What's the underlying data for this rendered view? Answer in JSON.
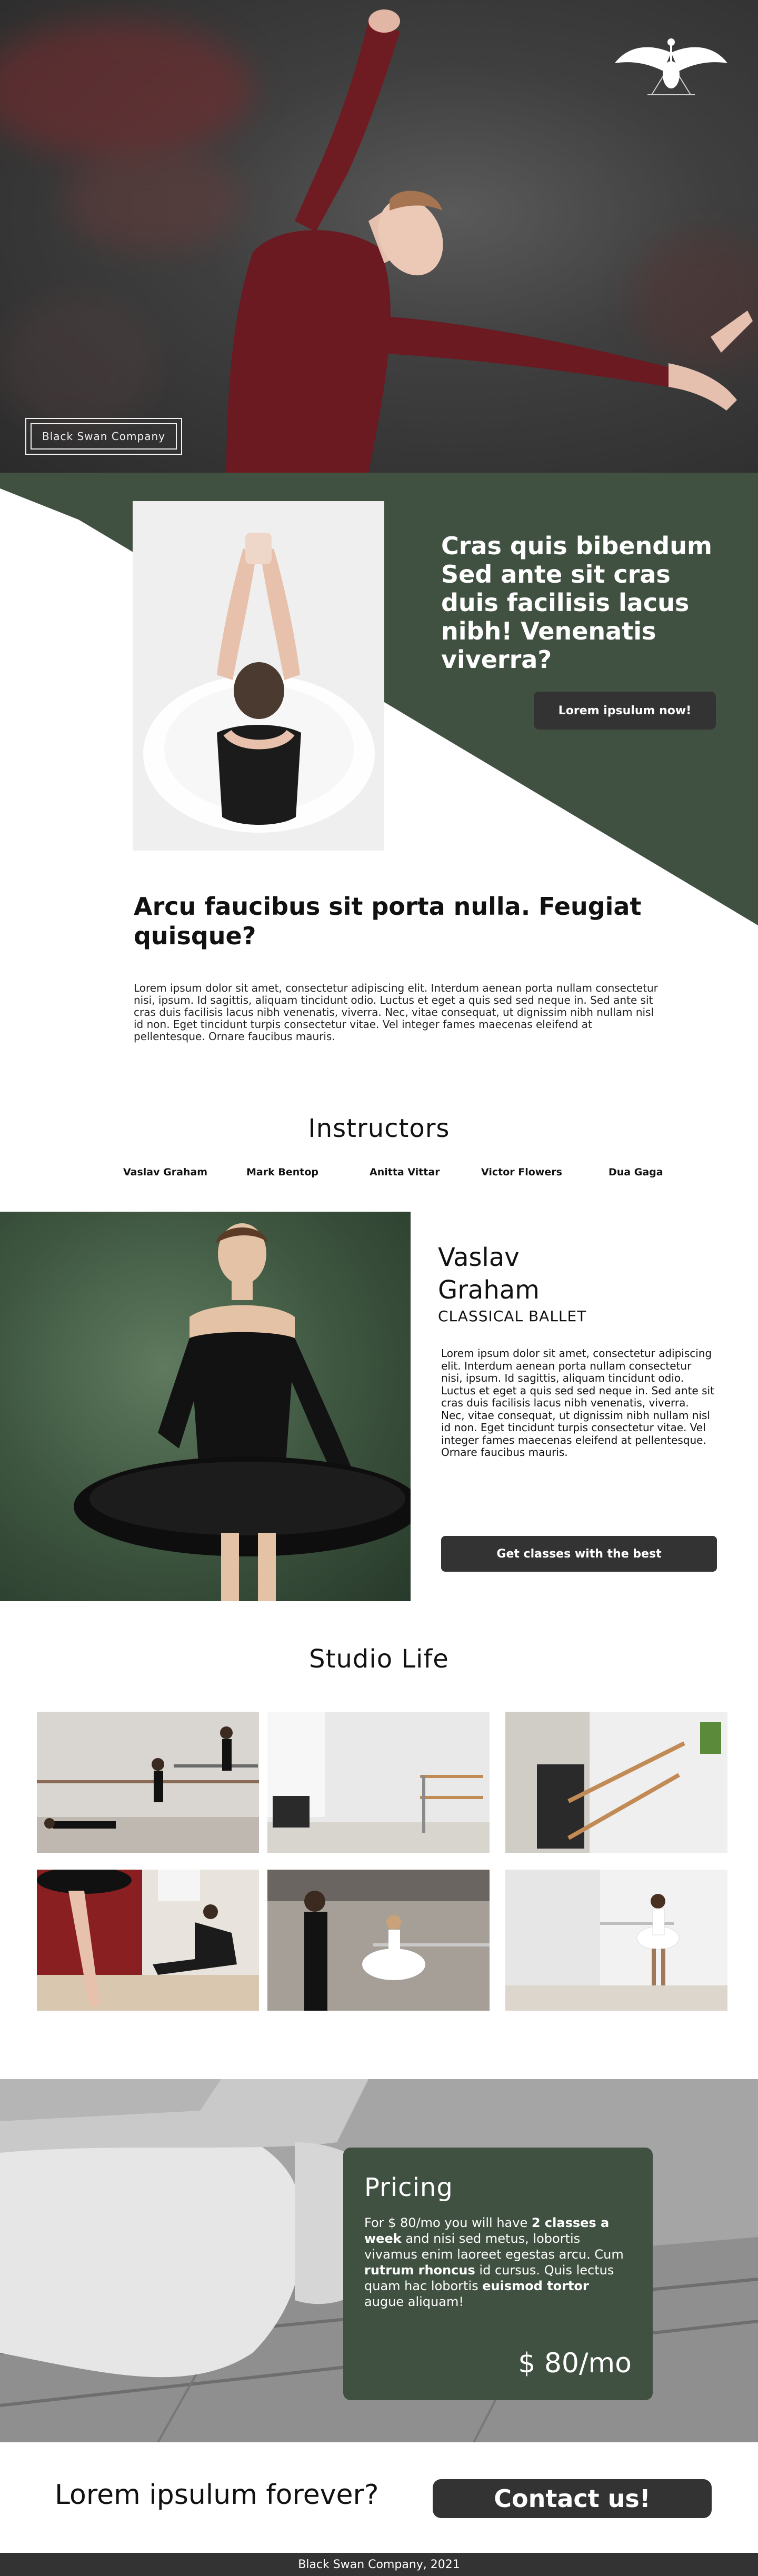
{
  "hero": {
    "brand": "Black Swan Company"
  },
  "intro": {
    "headline": "Cras quis bibendum Sed ante sit cras duis facilisis lacus nibh! Venenatis viverra?",
    "cta_label": "Lorem ipsulum now!"
  },
  "about": {
    "heading": "Arcu faucibus sit porta nulla. Feugiat quisque?",
    "body": "Lorem ipsum dolor sit amet, consectetur adipiscing elit. Interdum aenean porta nullam consectetur nisi, ipsum. Id sagittis, aliquam tincidunt odio. Luctus et eget a quis sed sed neque in. Sed ante sit cras duis facilisis lacus nibh venenatis, viverra. Nec, vitae consequat, ut dignissim nibh nullam nisl id non. Eget tincidunt turpis consectetur vitae. Vel integer fames maecenas eleifend at pellentesque. Ornare faucibus mauris."
  },
  "instructors": {
    "title": "Instructors",
    "tabs": [
      "Vaslav Graham",
      "Mark Bentop",
      "Anitta Vittar",
      "Victor Flowers",
      "Dua Gaga"
    ],
    "selected": {
      "name": "Vaslav Graham",
      "style": "CLASSICAL BALLET",
      "bio": "Lorem ipsum dolor sit amet, consectetur adipiscing elit. Interdum aenean porta nullam consectetur nisi, ipsum. Id sagittis, aliquam tincidunt odio. Luctus et eget a quis sed sed neque in. Sed ante sit cras duis facilisis lacus nibh venenatis, viverra. Nec, vitae consequat, ut dignissim nibh nullam nisl id non. Eget tincidunt turpis consectetur vitae. Vel integer fames maecenas eleifend at pellentesque. Ornare faucibus mauris.",
      "cta_label": "Get classes with the best"
    }
  },
  "studio": {
    "title": "Studio Life"
  },
  "pricing": {
    "title": "Pricing",
    "text_1": "For $ 80/mo you will have ",
    "bold_1": "2 classes a week",
    "text_2": " and nisi sed metus, lobortis vivamus enim laoreet egestas arcu. Cum ",
    "bold_2": "rutrum rhoncus",
    "text_3": " id cursus. Quis lectus quam hac lobortis ",
    "bold_3": "euismod tortor",
    "text_4": " augue aliquam!",
    "price": "$ 80/mo"
  },
  "contact": {
    "question": "Lorem ipsulum forever?",
    "button_label": "Contact us!"
  },
  "footer": {
    "text": "Black Swan Company, 2021"
  },
  "colors": {
    "forest_green": "#415141",
    "charcoal": "#333333"
  }
}
